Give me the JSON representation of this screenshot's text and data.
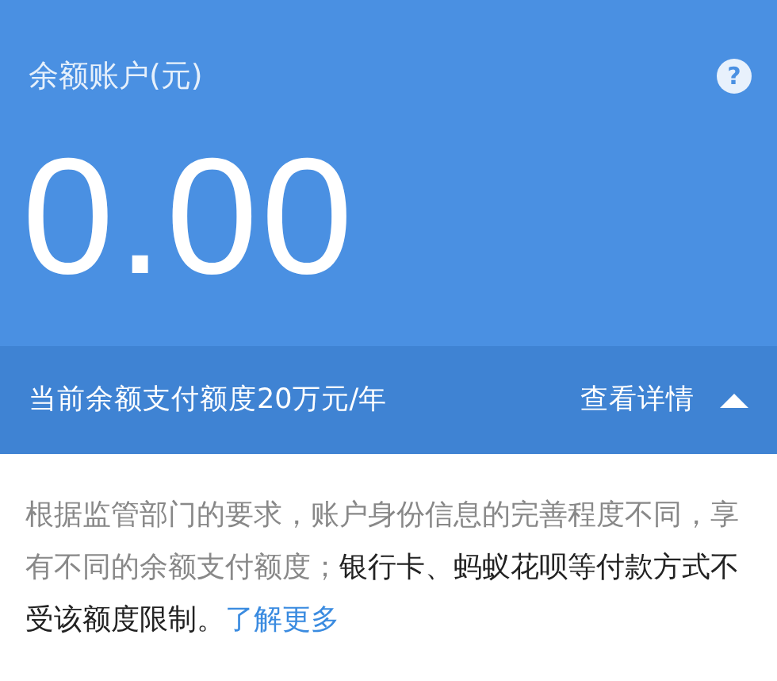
{
  "balance_card": {
    "title": "余额账户(元)",
    "help_icon": "?",
    "amount": "0.00"
  },
  "limit_bar": {
    "text": "当前余额支付额度20万元/年",
    "details_link": "查看详情",
    "expanded": true
  },
  "notice": {
    "segments": [
      {
        "text": "根据监管部门的要求，账户身份信息的完善程度不同，享有不同的余额支付额度；",
        "emphasis": false
      },
      {
        "text": "银行卡、蚂蚁花呗等付款方式不受该额度限制。",
        "emphasis": true
      }
    ],
    "link": "了解更多"
  }
}
